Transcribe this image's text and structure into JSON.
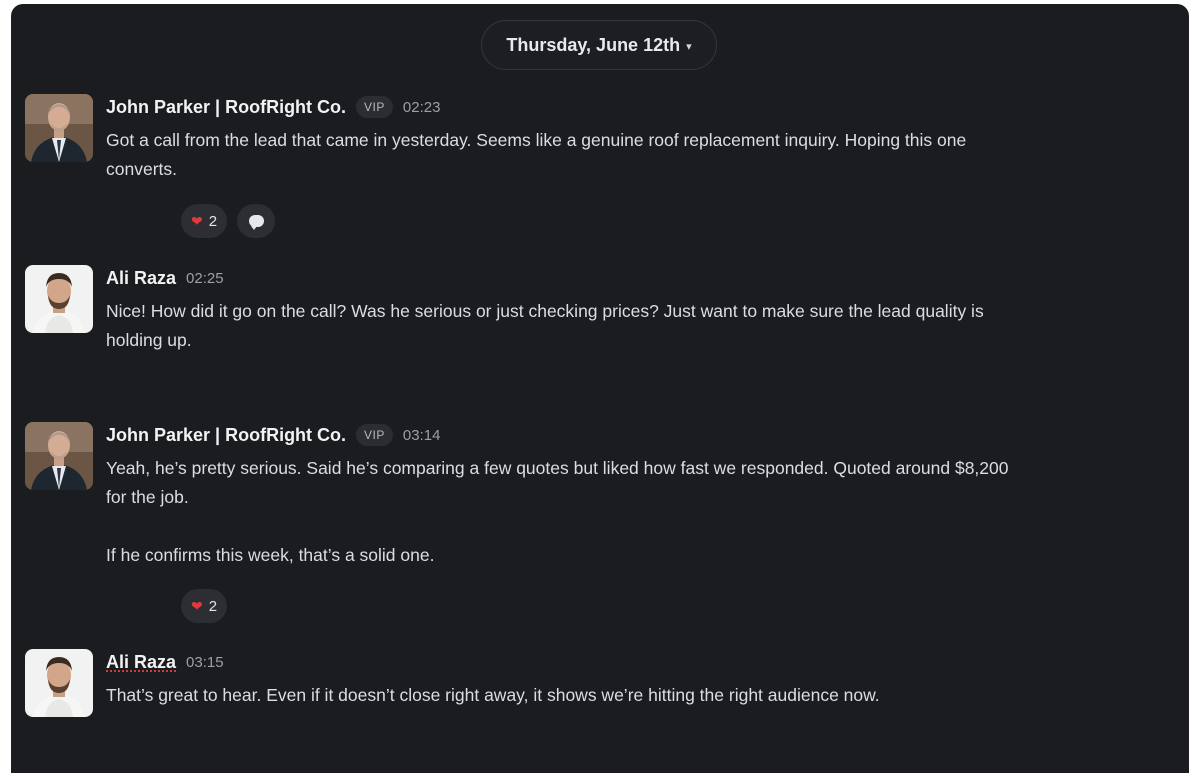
{
  "date_divider": {
    "label": "Thursday, June 12th",
    "caret": "▾"
  },
  "messages": [
    {
      "author": "John Parker | RoofRight Co.",
      "badge": "VIP",
      "time": "02:23",
      "text": "Got a call from the lead that came in yesterday. Seems like a genuine roof replacement inquiry. Hoping this one\nconverts.",
      "reactions": [
        {
          "icon": "heart-icon",
          "emoji": "❤",
          "count": "2"
        },
        {
          "icon": "comment-icon",
          "emoji": "",
          "count": ""
        }
      ]
    },
    {
      "author": "Ali Raza",
      "badge": "",
      "time": "02:25",
      "text": "Nice! How did it go on the call? Was he serious or just checking prices? Just want to make sure the lead quality is\nholding up.",
      "reactions": []
    },
    {
      "author": "John Parker | RoofRight Co.",
      "badge": "VIP",
      "time": "03:14",
      "text": "Yeah, he’s pretty serious. Said he’s comparing a few quotes but liked how fast we responded. Quoted around $8,200\nfor the job.\n\nIf he confirms this week, that’s a solid one.",
      "reactions": [
        {
          "icon": "heart-icon",
          "emoji": "❤",
          "count": "2"
        }
      ]
    },
    {
      "author": "Ali Raza",
      "badge": "",
      "time": "03:15",
      "text": "That’s great to hear. Even if it doesn’t close right away, it shows we’re hitting the right audience now.",
      "reactions": []
    }
  ],
  "colors": {
    "background": "#1b1c20",
    "heart": "#e5383b",
    "vip_badge": "#2b2d33"
  }
}
